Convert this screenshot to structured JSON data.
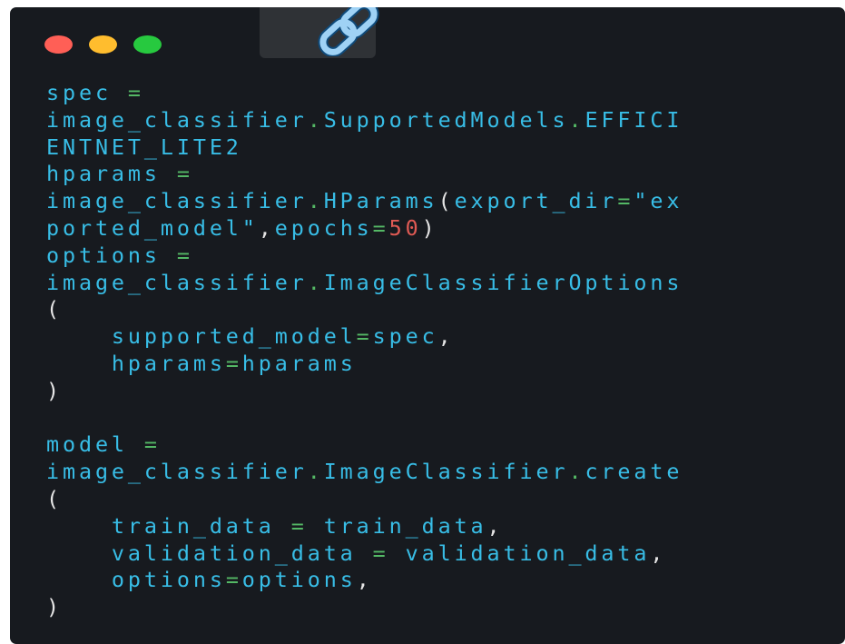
{
  "window": {
    "traffic_lights": [
      {
        "name": "close",
        "color": "#ff5f56"
      },
      {
        "name": "minimize",
        "color": "#ffbd2e"
      },
      {
        "name": "zoom",
        "color": "#27c93f"
      }
    ],
    "toolbar_icon": "link-icon"
  },
  "colors": {
    "background": "#171a1f",
    "identifier": "#38bde6",
    "operator": "#54b865",
    "number": "#e05a54",
    "punctuation": "#e6e6e6"
  },
  "code": {
    "lines": [
      [
        {
          "t": "spec ",
          "k": "id"
        },
        {
          "t": "=",
          "k": "op"
        }
      ],
      [
        {
          "t": "image_classifier",
          "k": "id"
        },
        {
          "t": ".",
          "k": "op"
        },
        {
          "t": "SupportedModels",
          "k": "id"
        },
        {
          "t": ".",
          "k": "op"
        },
        {
          "t": "EFFICI",
          "k": "id"
        }
      ],
      [
        {
          "t": "ENTNET_LITE2",
          "k": "id"
        }
      ],
      [
        {
          "t": "hparams ",
          "k": "id"
        },
        {
          "t": "=",
          "k": "op"
        }
      ],
      [
        {
          "t": "image_classifier",
          "k": "id"
        },
        {
          "t": ".",
          "k": "op"
        },
        {
          "t": "HParams",
          "k": "id"
        },
        {
          "t": "(",
          "k": "punc"
        },
        {
          "t": "export_dir",
          "k": "id"
        },
        {
          "t": "=",
          "k": "op"
        },
        {
          "t": "\"ex",
          "k": "id"
        }
      ],
      [
        {
          "t": "ported_model\"",
          "k": "id"
        },
        {
          "t": ",",
          "k": "punc"
        },
        {
          "t": "epochs",
          "k": "id"
        },
        {
          "t": "=",
          "k": "op"
        },
        {
          "t": "50",
          "k": "num"
        },
        {
          "t": ")",
          "k": "punc"
        }
      ],
      [
        {
          "t": "options ",
          "k": "id"
        },
        {
          "t": "=",
          "k": "op"
        }
      ],
      [
        {
          "t": "image_classifier",
          "k": "id"
        },
        {
          "t": ".",
          "k": "op"
        },
        {
          "t": "ImageClassifierOptions",
          "k": "id"
        }
      ],
      [
        {
          "t": "(",
          "k": "punc"
        }
      ],
      [
        {
          "t": "    supported_model",
          "k": "id"
        },
        {
          "t": "=",
          "k": "op"
        },
        {
          "t": "spec",
          "k": "id"
        },
        {
          "t": ",",
          "k": "punc"
        }
      ],
      [
        {
          "t": "    hparams",
          "k": "id"
        },
        {
          "t": "=",
          "k": "op"
        },
        {
          "t": "hparams",
          "k": "id"
        }
      ],
      [
        {
          "t": ")",
          "k": "punc"
        }
      ],
      [],
      [
        {
          "t": "model ",
          "k": "id"
        },
        {
          "t": "=",
          "k": "op"
        }
      ],
      [
        {
          "t": "image_classifier",
          "k": "id"
        },
        {
          "t": ".",
          "k": "op"
        },
        {
          "t": "ImageClassifier",
          "k": "id"
        },
        {
          "t": ".",
          "k": "op"
        },
        {
          "t": "create",
          "k": "id"
        }
      ],
      [
        {
          "t": "(",
          "k": "punc"
        }
      ],
      [
        {
          "t": "    train_data ",
          "k": "id"
        },
        {
          "t": "=",
          "k": "op"
        },
        {
          "t": " train_data",
          "k": "id"
        },
        {
          "t": ",",
          "k": "punc"
        }
      ],
      [
        {
          "t": "    validation_data ",
          "k": "id"
        },
        {
          "t": "=",
          "k": "op"
        },
        {
          "t": " validation_data",
          "k": "id"
        },
        {
          "t": ",",
          "k": "punc"
        }
      ],
      [
        {
          "t": "    options",
          "k": "id"
        },
        {
          "t": "=",
          "k": "op"
        },
        {
          "t": "options",
          "k": "id"
        },
        {
          "t": ",",
          "k": "punc"
        }
      ],
      [
        {
          "t": ")",
          "k": "punc"
        }
      ]
    ]
  }
}
